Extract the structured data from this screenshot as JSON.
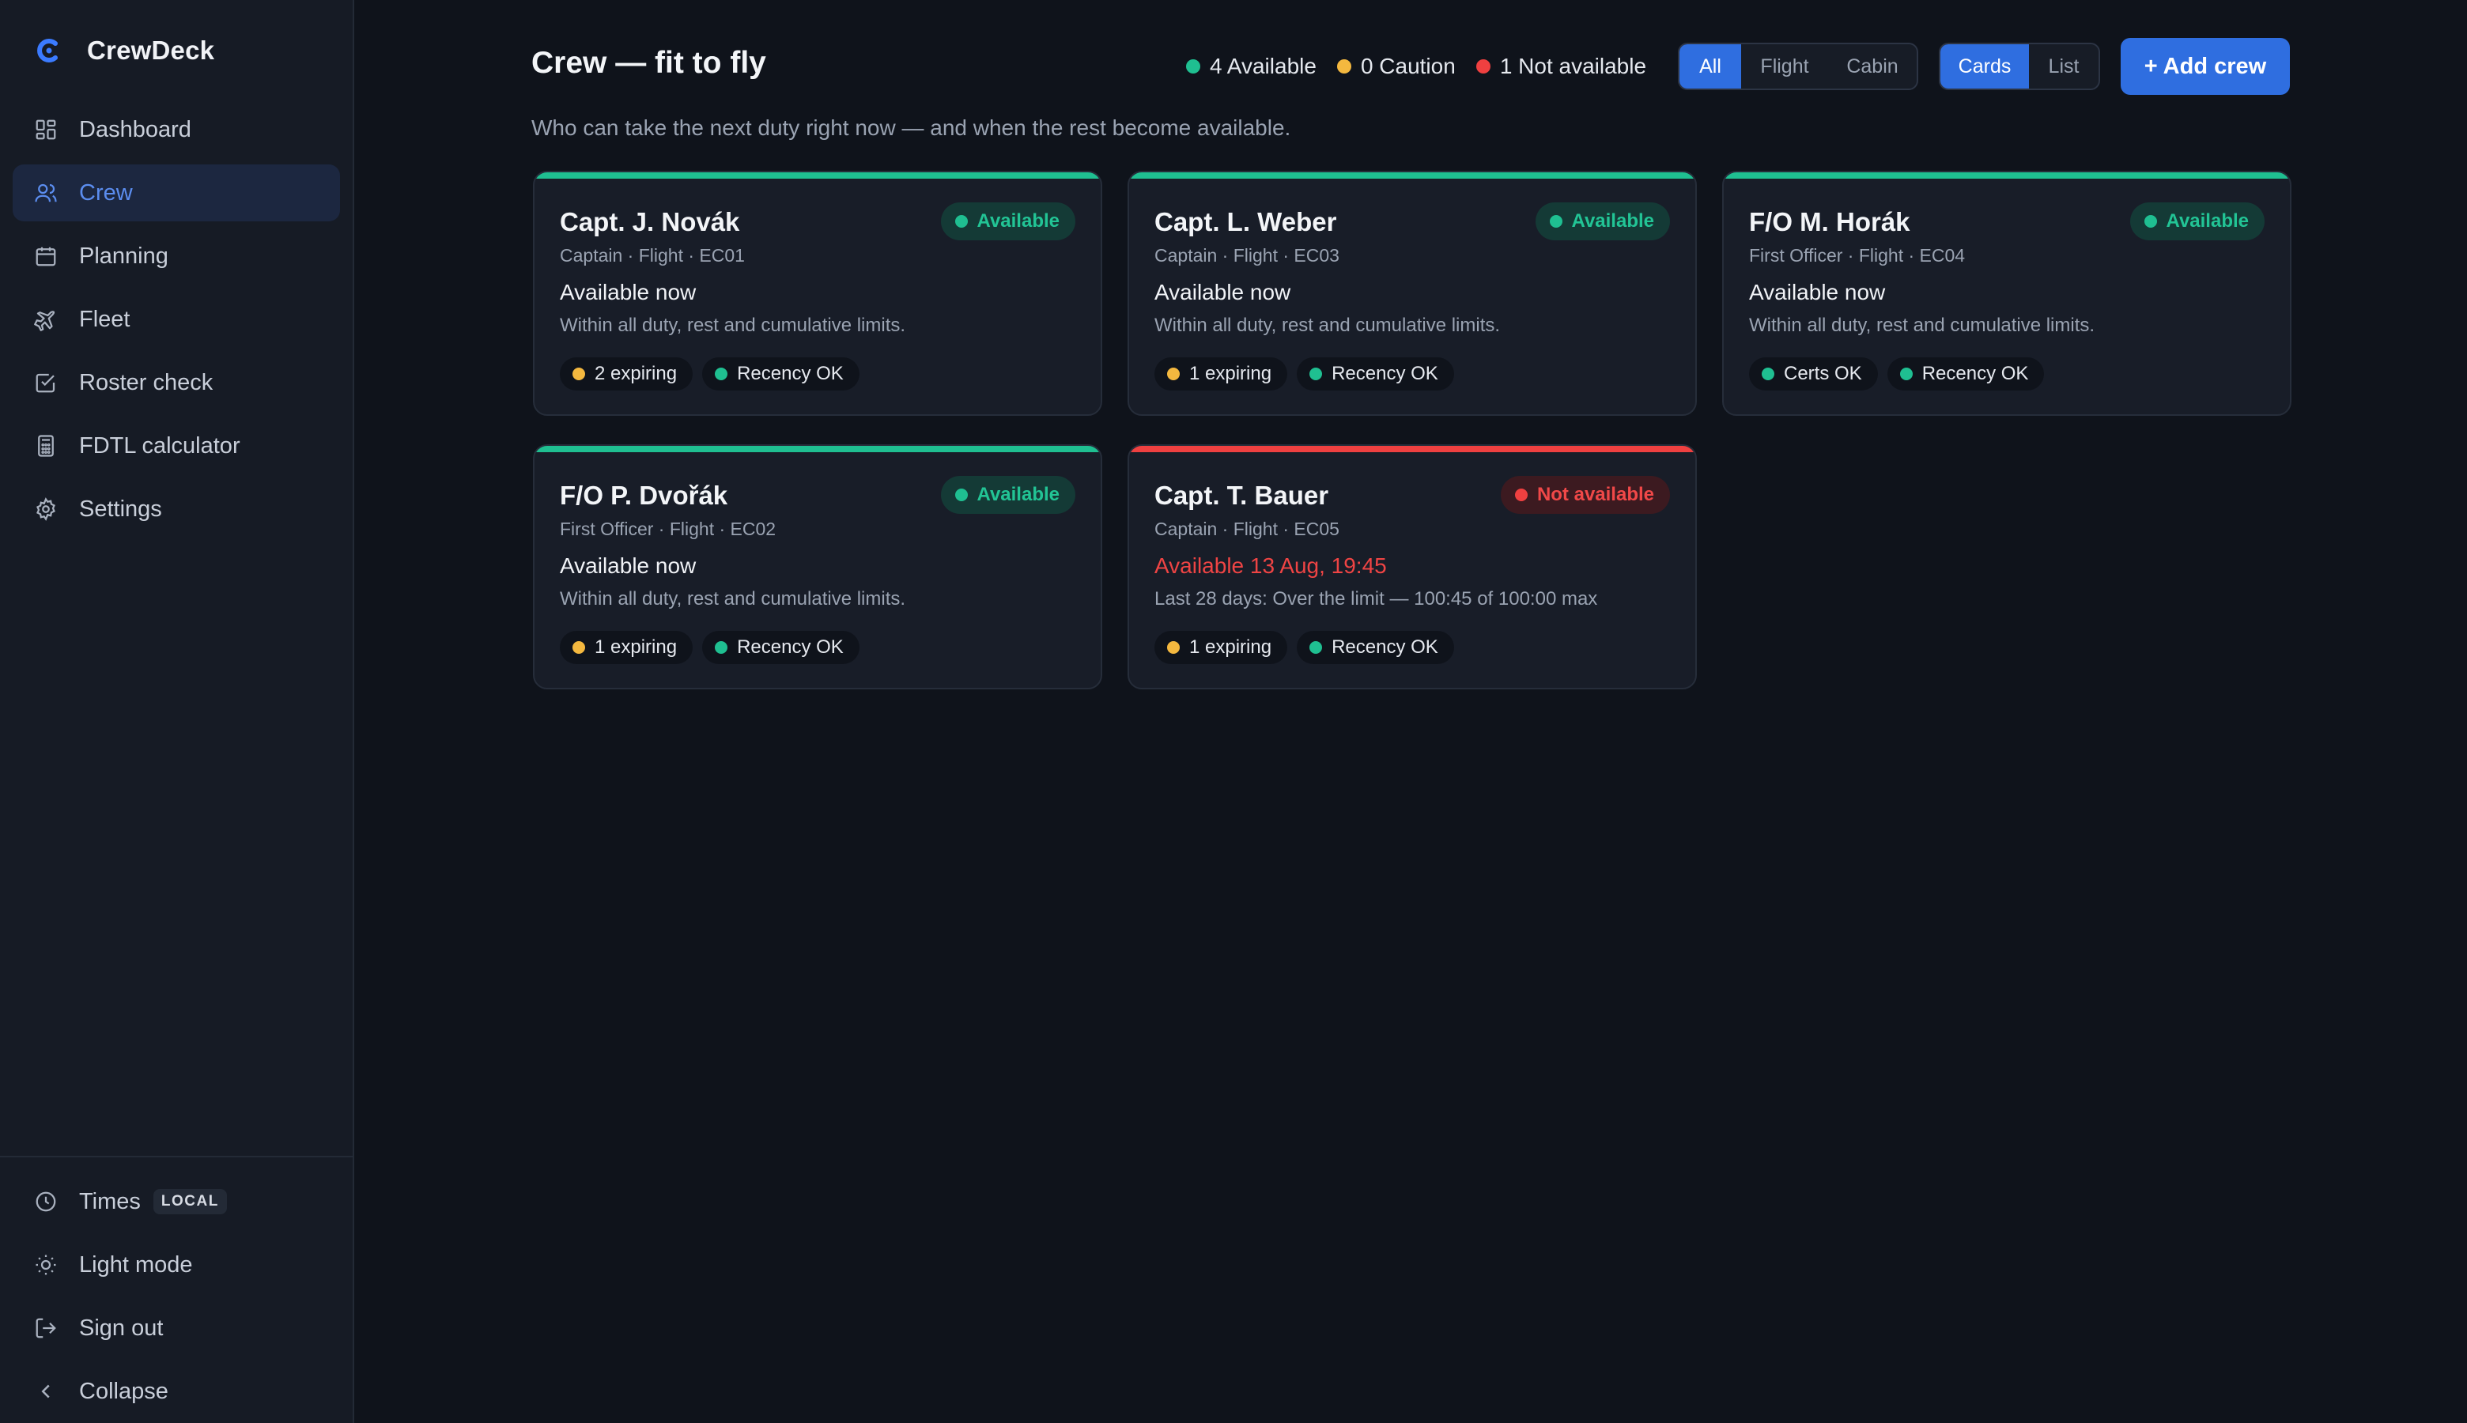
{
  "app": {
    "name": "CrewDeck"
  },
  "sidebar": {
    "items": [
      {
        "label": "Dashboard",
        "icon": "dashboard-icon"
      },
      {
        "label": "Crew",
        "icon": "users-icon",
        "active": true
      },
      {
        "label": "Planning",
        "icon": "calendar-icon"
      },
      {
        "label": "Fleet",
        "icon": "plane-icon"
      },
      {
        "label": "Roster check",
        "icon": "checkbox-icon"
      },
      {
        "label": "FDTL calculator",
        "icon": "calculator-icon"
      },
      {
        "label": "Settings",
        "icon": "gear-icon"
      }
    ],
    "bottom": {
      "times_label": "Times",
      "times_badge": "LOCAL",
      "theme_label": "Light mode",
      "signout_label": "Sign out",
      "collapse_label": "Collapse"
    }
  },
  "header": {
    "title": "Crew — fit to fly",
    "subtitle": "Who can take the next duty right now — and when the rest become available.",
    "summary": {
      "available": "4 Available",
      "caution": "0 Caution",
      "not_available": "1 Not available"
    },
    "filter": {
      "all": "All",
      "flight": "Flight",
      "cabin": "Cabin",
      "selected": "All"
    },
    "view": {
      "cards": "Cards",
      "list": "List",
      "selected": "Cards"
    },
    "add_button": "+ Add crew"
  },
  "colors": {
    "accent": "#2f6ee0",
    "available": "#1fbf91",
    "caution": "#f4b83f",
    "not_available": "#ef4040",
    "background": "#0f131b"
  },
  "crew": [
    {
      "name": "Capt. J. Novák",
      "meta": "Captain · Flight · EC01",
      "status": "Available",
      "availability": "Available now",
      "detail": "Within all duty, rest and cumulative limits.",
      "chip1": "2 expiring",
      "chip2": "Recency OK"
    },
    {
      "name": "Capt. L. Weber",
      "meta": "Captain · Flight · EC03",
      "status": "Available",
      "availability": "Available now",
      "detail": "Within all duty, rest and cumulative limits.",
      "chip1": "1 expiring",
      "chip2": "Recency OK"
    },
    {
      "name": "F/O M. Horák",
      "meta": "First Officer · Flight · EC04",
      "status": "Available",
      "availability": "Available now",
      "detail": "Within all duty, rest and cumulative limits.",
      "chip1": "Certs OK",
      "chip2": "Recency OK"
    },
    {
      "name": "F/O P. Dvořák",
      "meta": "First Officer · Flight · EC02",
      "status": "Available",
      "availability": "Available now",
      "detail": "Within all duty, rest and cumulative limits.",
      "chip1": "1 expiring",
      "chip2": "Recency OK"
    },
    {
      "name": "Capt. T. Bauer",
      "meta": "Captain · Flight · EC05",
      "status": "Not available",
      "availability": "Available 13 Aug, 19:45",
      "detail": "Last 28 days: Over the limit — 100:45 of 100:00 max",
      "chip1": "1 expiring",
      "chip2": "Recency OK"
    }
  ]
}
